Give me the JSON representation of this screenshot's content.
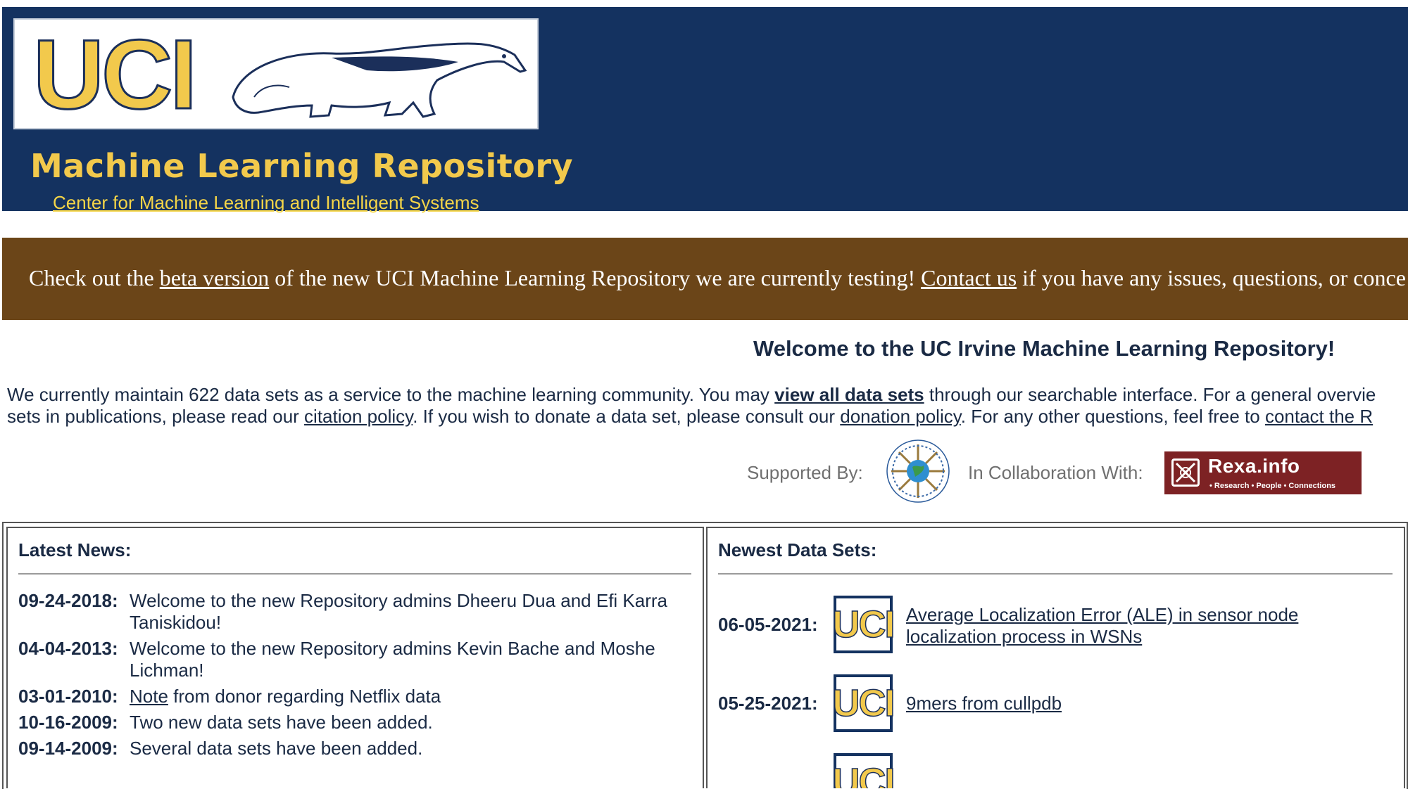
{
  "header": {
    "logo_text": "UCI",
    "title": "Machine Learning Repository",
    "subtitle_link": "Center for Machine Learning and Intelligent Systems"
  },
  "banner": {
    "prefix": "Check out the",
    "beta_link": "beta version",
    "middle": "of the new UCI Machine Learning Repository we are currently testing!",
    "contact_link": "Contact us",
    "suffix": "if you have any issues, questions, or conce"
  },
  "welcome": {
    "heading": "Welcome to the UC Irvine Machine Learning Repository!",
    "line1_a": "We currently maintain 622 data sets as a service to the machine learning community. You may",
    "view_all_link": "view all data sets",
    "line1_b": "through our searchable interface. For a general overvie",
    "line2_a": "sets in publications, please read our",
    "citation_link": "citation policy",
    "line2_b": ". If you wish to donate a data set, please consult our",
    "donation_link": "donation policy",
    "line2_c": ". For any other questions, feel free to",
    "contact_link": "contact the R"
  },
  "supporters": {
    "supported_label": "Supported By:",
    "collab_label": "In Collaboration With:",
    "rexa_name": "Rexa.info",
    "rexa_tagline": "• Research • People • Connections"
  },
  "news": {
    "title": "Latest News:",
    "items": [
      {
        "date": "09-24-2018:",
        "text": "Welcome to the new Repository admins Dheeru Dua and Efi Karra Taniskidou!"
      },
      {
        "date": "04-04-2013:",
        "text": "Welcome to the new Repository admins Kevin Bache and Moshe Lichman!"
      },
      {
        "date": "03-01-2010:",
        "link": "Note",
        "text": " from donor regarding Netflix data"
      },
      {
        "date": "10-16-2009:",
        "text": "Two new data sets have been added."
      },
      {
        "date": "09-14-2009:",
        "text": "Several data sets have been added."
      }
    ]
  },
  "datasets": {
    "title": "Newest Data Sets:",
    "thumb_text": "UCI",
    "items": [
      {
        "date": "06-05-2021:",
        "name": "Average Localization Error (ALE) in sensor node localization process in WSNs"
      },
      {
        "date": "05-25-2021:",
        "name": "9mers from cullpdb"
      }
    ]
  },
  "colors": {
    "header_bg": "#143260",
    "banner_bg": "#6b4518",
    "logo_yellow": "#f2c94c",
    "rexa_bg": "#7d2224"
  }
}
